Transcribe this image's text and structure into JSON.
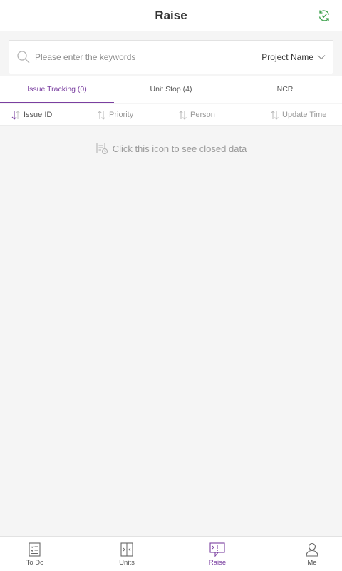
{
  "header": {
    "title": "Raise",
    "refresh_icon": "refresh-icon",
    "accent_color": "#3aa04a"
  },
  "search": {
    "placeholder": "Please enter the keywords",
    "value": "",
    "filter_label": "Project Name"
  },
  "tabs": [
    {
      "label": "Issue Tracking (0)",
      "active": true
    },
    {
      "label": "Unit Stop (4)",
      "active": false
    },
    {
      "label": "NCR",
      "active": false
    }
  ],
  "sort_columns": [
    {
      "label": "Issue ID",
      "icon": "sort-desc-icon"
    },
    {
      "label": "Priority",
      "icon": "sort-icon"
    },
    {
      "label": "Person",
      "icon": "sort-icon"
    },
    {
      "label": "Update Time",
      "icon": "sort-icon"
    }
  ],
  "empty_state": {
    "text": "Click this icon to see closed data",
    "icon": "closed-records-icon"
  },
  "bottom_nav": [
    {
      "label": "To Do",
      "icon": "todo-icon",
      "active": false
    },
    {
      "label": "Units",
      "icon": "units-icon",
      "active": false
    },
    {
      "label": "Raise",
      "icon": "raise-icon",
      "active": true
    },
    {
      "label": "Me",
      "icon": "person-icon",
      "active": false
    }
  ],
  "colors": {
    "brand_purple": "#7a3fa0",
    "refresh_green": "#3aa04a"
  }
}
